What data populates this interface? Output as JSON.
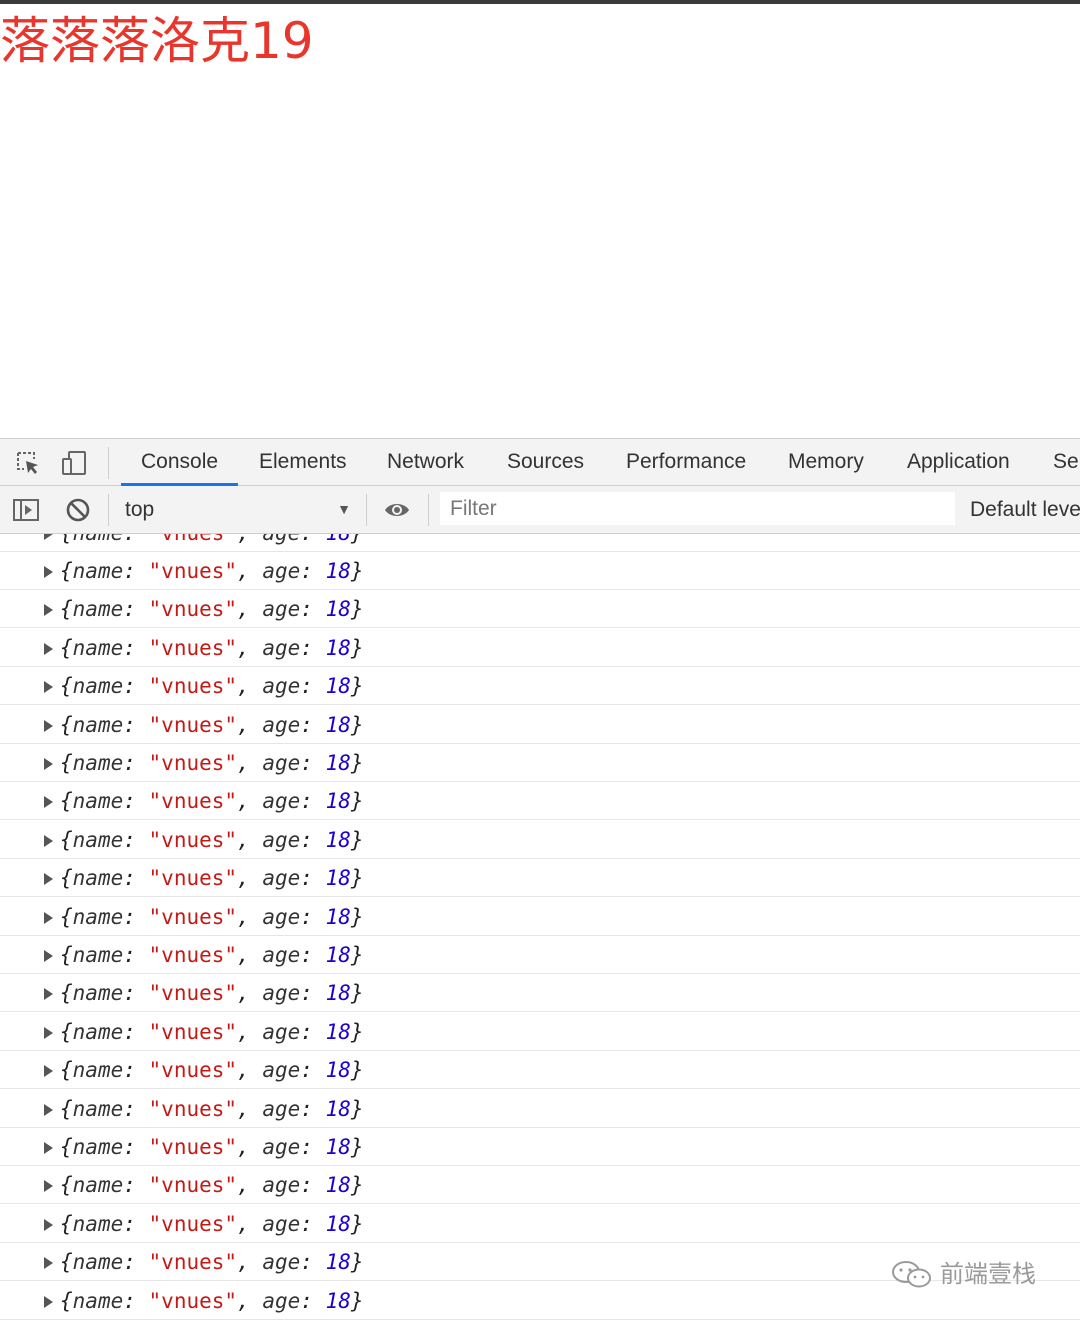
{
  "page": {
    "heading": "落落落洛克19"
  },
  "devtools": {
    "icons": {
      "inspect": "inspect-element-icon",
      "device": "device-toggle-icon",
      "sidebar": "sidebar-toggle-icon",
      "clear": "clear-console-icon",
      "eye": "live-expression-eye-icon"
    },
    "tabs": [
      {
        "label": "Console",
        "active": true
      },
      {
        "label": "Elements"
      },
      {
        "label": "Network"
      },
      {
        "label": "Sources"
      },
      {
        "label": "Performance"
      },
      {
        "label": "Memory"
      },
      {
        "label": "Application"
      },
      {
        "label": "Se"
      }
    ],
    "toolbar": {
      "context": "top",
      "filter_placeholder": "Filter",
      "levels": "Default leve"
    },
    "log": {
      "entry": {
        "name_key": "name",
        "name_value": "\"vnues\"",
        "age_key": "age",
        "age_value": "18"
      },
      "visible_full_rows": 20
    },
    "colors": {
      "accent": "#1a73e8",
      "string": "#c41a16",
      "number": "#1c00cf",
      "heading": "#e8362c"
    }
  },
  "watermark": {
    "text": "前端壹栈",
    "icon": "wechat-icon"
  }
}
